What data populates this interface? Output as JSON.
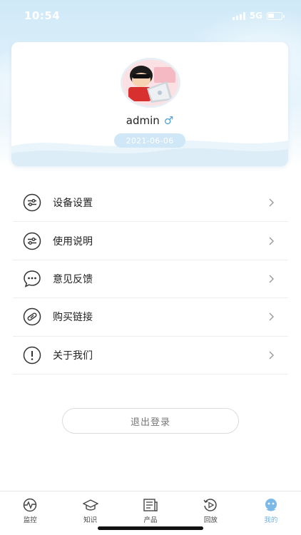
{
  "status_bar": {
    "time": "10:54",
    "network": "5G"
  },
  "profile": {
    "username": "admin",
    "gender_symbol": "♂",
    "date": "2021-06-06"
  },
  "menu": [
    {
      "label": "设备设置",
      "icon": "sliders-icon"
    },
    {
      "label": "使用说明",
      "icon": "sliders-icon"
    },
    {
      "label": "意见反馈",
      "icon": "chat-bubble-icon"
    },
    {
      "label": "购买链接",
      "icon": "link-icon"
    },
    {
      "label": "关于我们",
      "icon": "info-icon"
    }
  ],
  "logout_label": "退出登录",
  "tabs": [
    {
      "label": "监控",
      "icon": "monitor-wave-icon",
      "active": false
    },
    {
      "label": "知识",
      "icon": "graduation-cap-icon",
      "active": false
    },
    {
      "label": "产品",
      "icon": "newspaper-icon",
      "active": false
    },
    {
      "label": "回放",
      "icon": "replay-icon",
      "active": false
    },
    {
      "label": "我的",
      "icon": "user-face-icon",
      "active": true
    }
  ],
  "colors": {
    "accent": "#6fb2e4",
    "date_pill": "#cfe7f6",
    "gender": "#4da4d4"
  }
}
